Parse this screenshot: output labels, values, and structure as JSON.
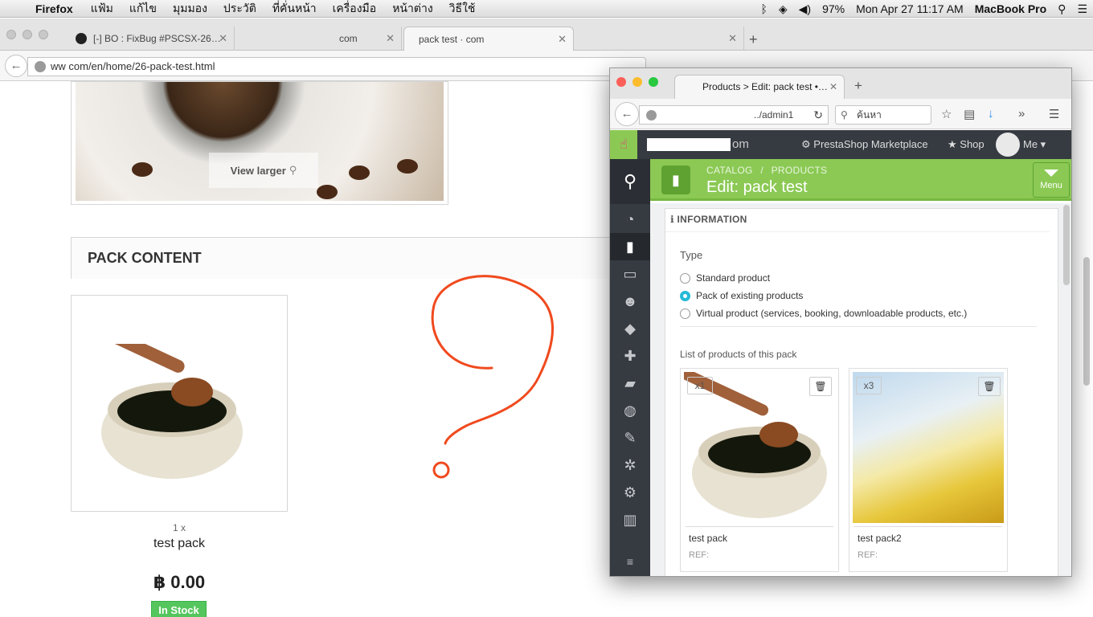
{
  "menubar": {
    "app": "Firefox",
    "items": [
      "แฟ้ม",
      "แก้ไข",
      "มุมมอง",
      "ประวัติ",
      "ที่คั่นหน้า",
      "เครื่องมือ",
      "หน้าต่าง",
      "วิธีใช้"
    ],
    "battery": "97%",
    "datetime": "Mon Apr 27  11:17 AM",
    "device": "MacBook Pro"
  },
  "back_browser": {
    "tabs": [
      {
        "label": "[-] BO : FixBug #PSCSX-26…"
      },
      {
        "label": "com"
      },
      {
        "label": "pack test ·             com"
      },
      {
        "label": ""
      }
    ],
    "url": "ww                      com/en/home/26-pack-test.html"
  },
  "storefront": {
    "view_larger": "View larger",
    "pack_content_title": "PACK CONTENT",
    "item_qty": "1 x",
    "item_name": "test pack",
    "price": "฿ 0.00",
    "stock": "In Stock"
  },
  "front_browser": {
    "tab_title": "Products > Edit: pack test •…",
    "url": "../admin1",
    "search_placeholder": "ค้นหา"
  },
  "admin": {
    "shop_suffix": "om",
    "marketplace": "PrestaShop Marketplace",
    "shop": "Shop",
    "me": "Me",
    "breadcrumb_catalog": "CATALOG",
    "breadcrumb_sep": "/",
    "breadcrumb_products": "PRODUCTS",
    "page_title": "Edit: pack test",
    "menu_button": "Menu",
    "panel_title": "INFORMATION",
    "type_label": "Type",
    "types": [
      {
        "label": "Standard product",
        "selected": false
      },
      {
        "label": "Pack of existing products",
        "selected": true
      },
      {
        "label": "Virtual product (services, booking, downloadable products, etc.)",
        "selected": false
      }
    ],
    "list_label": "List of products of this pack",
    "pack_items": [
      {
        "qty": "x1",
        "name": "test pack",
        "ref": "REF:"
      },
      {
        "qty": "x3",
        "name": "test pack2",
        "ref": "REF:"
      }
    ]
  },
  "colors": {
    "accent_green": "#8bc954",
    "admin_dark": "#363a41",
    "annotation_red": "#f04a1e",
    "stock_green": "#55c65e"
  }
}
